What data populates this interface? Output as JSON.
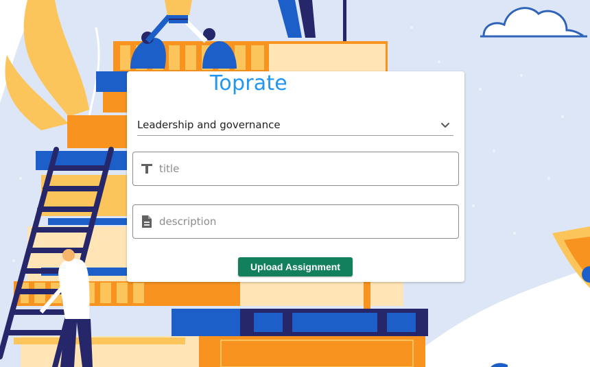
{
  "app": {
    "brand": "Toprate"
  },
  "form": {
    "category": {
      "selected": "Leadership and governance"
    },
    "title": {
      "value": "",
      "placeholder": "title"
    },
    "description": {
      "value": "",
      "placeholder": "description"
    },
    "submit_label": "Upload Assignment"
  },
  "icons": {
    "category_toggle": "chevron-down-icon",
    "title_field": "text-format-icon",
    "description_field": "document-icon"
  },
  "colors": {
    "brand": "#2196f3",
    "submit_button": "#12805c",
    "illustration_orange": "#f7931e",
    "illustration_yellow": "#fbc55b",
    "illustration_navy": "#26276b",
    "illustration_blue": "#1d5fc8",
    "background_blob": "#dde6f7"
  }
}
